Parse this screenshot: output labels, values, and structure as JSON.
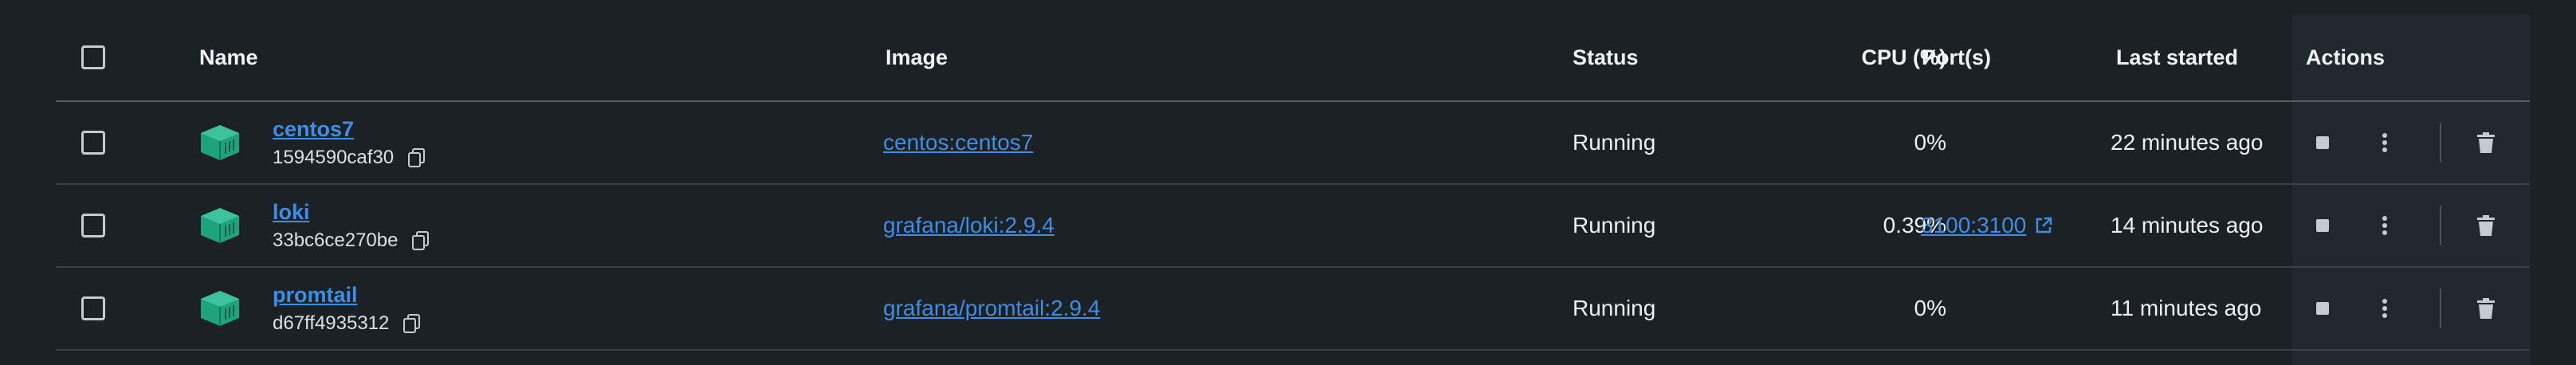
{
  "table": {
    "headers": {
      "name": "Name",
      "image": "Image",
      "status": "Status",
      "cpu": "CPU (%)",
      "ports": "Port(s)",
      "last_started": "Last started",
      "actions": "Actions"
    },
    "rows": [
      {
        "name": "centos7",
        "id": "1594590caf30",
        "image": "centos:centos7",
        "status": "Running",
        "cpu": "0%",
        "ports": "",
        "last_started": "22 minutes ago"
      },
      {
        "name": "loki",
        "id": "33bc6ce270be",
        "image": "grafana/loki:2.9.4",
        "status": "Running",
        "cpu": "0.39%",
        "ports": "3100:3100",
        "last_started": "14 minutes ago"
      },
      {
        "name": "promtail",
        "id": "d67ff4935312",
        "image": "grafana/promtail:2.9.4",
        "status": "Running",
        "cpu": "0%",
        "ports": "",
        "last_started": "11 minutes ago"
      }
    ]
  },
  "icons": {
    "container": "container-icon",
    "copy": "copy-icon",
    "external_link": "external-link-icon",
    "stop": "stop-icon",
    "more": "more-vertical-icon",
    "delete": "trash-icon"
  },
  "colors": {
    "background": "#1c2126",
    "actions_column": "#222830",
    "link": "#3e8ee6",
    "container_icon": "#1fa37f"
  }
}
